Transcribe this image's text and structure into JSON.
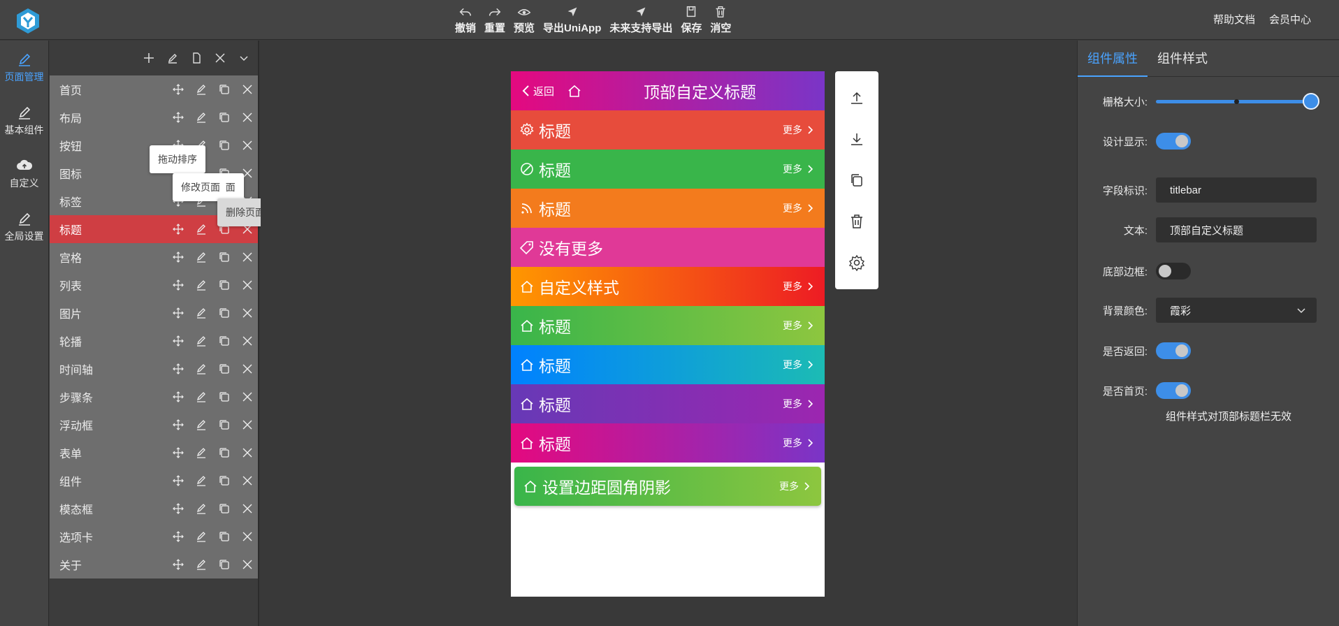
{
  "toolbar": [
    {
      "label": "撤销",
      "icon": "undo-icon"
    },
    {
      "label": "重置",
      "icon": "redo-icon"
    },
    {
      "label": "预览",
      "icon": "eye-icon"
    },
    {
      "label": "导出UniApp",
      "icon": "send-icon"
    },
    {
      "label": "未来支持导出",
      "icon": "send-icon"
    },
    {
      "label": "保存",
      "icon": "save-icon"
    },
    {
      "label": "消空",
      "icon": "trash-icon"
    }
  ],
  "top_links": {
    "help": "帮助文档",
    "member": "会员中心"
  },
  "left_nav": [
    {
      "label": "页面管理",
      "icon": "pencil-icon",
      "active": true
    },
    {
      "label": "基本组件",
      "icon": "pencil-icon",
      "active": false
    },
    {
      "label": "自定义",
      "icon": "cloud-upload-icon",
      "active": false
    },
    {
      "label": "全局设置",
      "icon": "pencil-icon",
      "active": false
    }
  ],
  "pages": [
    {
      "label": "首页"
    },
    {
      "label": "布局"
    },
    {
      "label": "按钮"
    },
    {
      "label": "图标"
    },
    {
      "label": "标签"
    },
    {
      "label": "标题",
      "active": true
    },
    {
      "label": "宫格"
    },
    {
      "label": "列表"
    },
    {
      "label": "图片"
    },
    {
      "label": "轮播"
    },
    {
      "label": "时间轴"
    },
    {
      "label": "步骤条"
    },
    {
      "label": "浮动框"
    },
    {
      "label": "表单"
    },
    {
      "label": "组件"
    },
    {
      "label": "模态框"
    },
    {
      "label": "选项卡"
    },
    {
      "label": "关于"
    }
  ],
  "tooltips": {
    "sort": "拖动排序",
    "edit": "修改页面",
    "edit_partial": "面",
    "delete": "删除页面"
  },
  "phone": {
    "header": {
      "back": "返回",
      "title": "顶部自定义标题"
    },
    "bars": [
      {
        "text": "标题",
        "more": "更多",
        "icon": "gear-icon",
        "bg": "#e74c3c",
        "has_more": true
      },
      {
        "text": "标题",
        "more": "更多",
        "icon": "compass-icon",
        "bg": "#39b54a",
        "has_more": true
      },
      {
        "text": "标题",
        "more": "更多",
        "icon": "rss-icon",
        "bg": "#f37b1d",
        "has_more": true
      },
      {
        "text": "没有更多",
        "more": "",
        "icon": "tag-icon",
        "bg": "#e03997",
        "has_more": false
      },
      {
        "text": "自定义样式",
        "more": "更多",
        "icon": "home-icon",
        "bg": "#ff8c00",
        "has_more": true
      },
      {
        "text": "标题",
        "more": "更多",
        "icon": "home-icon",
        "bg": "#39b54a",
        "has_more": true
      },
      {
        "text": "标题",
        "more": "更多",
        "icon": "home-icon",
        "bg": "#0081ff",
        "has_more": true
      },
      {
        "text": "标题",
        "more": "更多",
        "icon": "home-icon",
        "bg": "#6739b6",
        "has_more": true
      },
      {
        "text": "标题",
        "more": "更多",
        "icon": "home-icon",
        "bg": "#e4097f",
        "has_more": true
      },
      {
        "text": "设置边距圆角阴影",
        "more": "更多",
        "icon": "home-icon",
        "bg": "#39b54a",
        "has_more": true
      }
    ]
  },
  "side_actions": [
    "move-up-icon",
    "move-down-icon",
    "copy-icon",
    "delete-icon",
    "settings-icon"
  ],
  "right_panel": {
    "tabs": [
      {
        "label": "组件属性",
        "active": true
      },
      {
        "label": "组件样式",
        "active": false
      }
    ],
    "grid_size": {
      "label": "栅格大小:",
      "value": 100
    },
    "design_show": {
      "label": "设计显示:",
      "on": true
    },
    "field_id": {
      "label": "字段标识:",
      "value": "titlebar"
    },
    "text": {
      "label": "文本:",
      "value": "顶部自定义标题"
    },
    "bottom_border": {
      "label": "底部边框:",
      "on": false
    },
    "bg_color": {
      "label": "背景颜色:",
      "value": "霞彩"
    },
    "show_back": {
      "label": "是否返回:",
      "on": true
    },
    "show_home": {
      "label": "是否首页:",
      "on": true
    },
    "note": "组件样式对顶部标题栏无效"
  },
  "colors": {
    "accent": "#4aa3ff",
    "active_page": "#cf3e43",
    "toggle_on": "#3d8ee8"
  }
}
